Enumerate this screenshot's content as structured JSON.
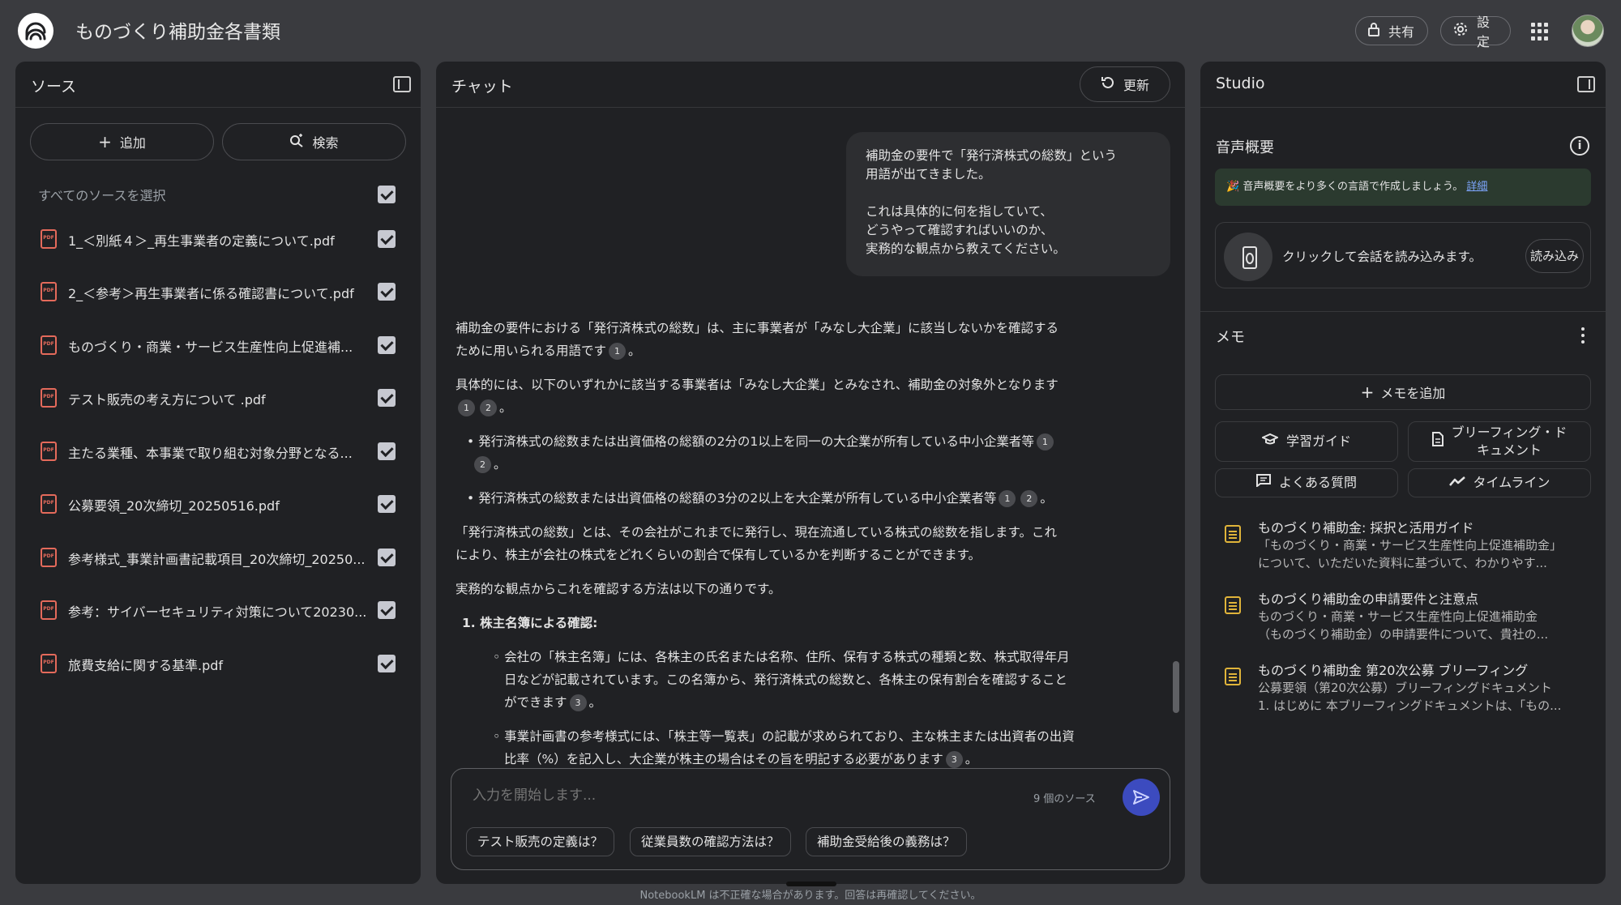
{
  "header": {
    "title": "ものづくり補助金各書類",
    "share_label": "共有",
    "settings_label": "設定"
  },
  "sources": {
    "title": "ソース",
    "add_label": "追加",
    "search_label": "検索",
    "select_all_label": "すべてのソースを選択",
    "items": [
      {
        "label": "1_＜別紙４＞_再生事業者の定義について.pdf",
        "checked": true
      },
      {
        "label": "2_＜参考＞再生事業者に係る確認書について.pdf",
        "checked": true
      },
      {
        "label": "ものづくり・商業・サービス生産性向上促進補...",
        "checked": true
      },
      {
        "label": "テスト販売の考え方について .pdf",
        "checked": true
      },
      {
        "label": "主たる業種、本事業で取り組む対象分野となる...",
        "checked": true
      },
      {
        "label": "公募要領_20次締切_20250516.pdf",
        "checked": true
      },
      {
        "label": "参考様式_事業計画書記載項目_20次締切_20250...",
        "checked": true
      },
      {
        "label": "参考：サイバーセキュリティ対策について20230...",
        "checked": true
      },
      {
        "label": "旅費支給に関する基準.pdf",
        "checked": true
      }
    ]
  },
  "chat": {
    "title": "チャット",
    "refresh_label": "更新",
    "user_message": {
      "line1": "補助金の要件で「発行済株式の総数」という",
      "line2": "用語が出てきました。",
      "line3": "これは具体的に何を指していて、",
      "line4": "どうやって確認すればいいのか、",
      "line5": "実務的な観点から教えてください。"
    },
    "answer": {
      "p1_l1": "補助金の要件における「発行済株式の総数」は、主に事業者が「みなし大企業」に該当しないかを確認する",
      "p1_l2": "ために用いられる用語です",
      "p2_l1": "具体的には、以下のいずれかに該当する事業者は「みなし大企業」とみなされ、補助金の対象外となります",
      "b1": "• 発行済株式の総数または出資価格の総額の2分の1以上を同一の大企業が所有している中小企業者等",
      "b2": "• 発行済株式の総数または出資価格の総額の3分の2以上を大企業が所有している中小企業者等",
      "p3_l1": "「発行済株式の総数」とは、その会社がこれまでに発行し、現在流通している株式の総数を指します。これ",
      "p3_l2": "により、株主が会社の株式をどれくらいの割合で保有しているかを判断することができます。",
      "p4": "実務的な観点からこれを確認する方法は以下の通りです。",
      "h1": "1. 株主名簿による確認:",
      "s1_l1": "◦ 会社の「株主名簿」には、各株主の氏名または名称、住所、保有する株式の種類と数、株式取得年月",
      "s1_l2": "日などが記載されています。この名簿から、発行済株式の総数と、各株主の保有割合を確認すること",
      "s1_l3": "ができます",
      "s2_l1": "◦ 事業計画書の参考様式には、「株主等一覧表」の記載が求められており、主な株主または出資者の出資",
      "s2_l2": "比率（%）を記入し、大企業が株主の場合はその旨を明記する必要があります",
      "period": "。",
      "cite1": "1",
      "cite2": "2",
      "cite3": "3"
    },
    "input_placeholder": "入力を開始します...",
    "source_count": "9 個のソース",
    "suggestions": [
      "テスト販売の定義は？",
      "従業員数の確認方法は？",
      "補助金受給後の義務は？"
    ]
  },
  "studio": {
    "title": "Studio",
    "audio_title": "音声概要",
    "banner_text": "🎉 音声概要をより多くの言語で作成しましょう。",
    "banner_link": "詳細",
    "load_text": "クリックして会話を読み込みます。",
    "load_button": "読み込み",
    "memo_title": "メモ",
    "add_memo_label": "メモを追加",
    "tools": {
      "study_guide": "学習ガイド",
      "briefing_l1": "ブリーフィング・ド",
      "briefing_l2": "キュメント",
      "faq": "よくある質問",
      "timeline": "タイムライン"
    },
    "notes": [
      {
        "title": "ものづくり補助金: 採択と活用ガイド",
        "line1": "「ものづくり・商業・サービス生産性向上促進補助金」",
        "line2": "について、いただいた資料に基づいて、わかりやす..."
      },
      {
        "title": "ものづくり補助金の申請要件と注意点",
        "line1": "ものづくり・商業・サービス生産性向上促進補助金",
        "line2": "（ものづくり補助金）の申請要件について、貴社の..."
      },
      {
        "title": "ものづくり補助金 第20次公募 ブリーフィング",
        "line1": "公募要領（第20次公募）ブリーフィングドキュメント",
        "line2": "1. はじめに 本ブリーフィングドキュメントは、「もの..."
      }
    ]
  },
  "footer": {
    "disclaimer": "NotebookLM は不正確な場合があります。回答は再確認してください。"
  }
}
